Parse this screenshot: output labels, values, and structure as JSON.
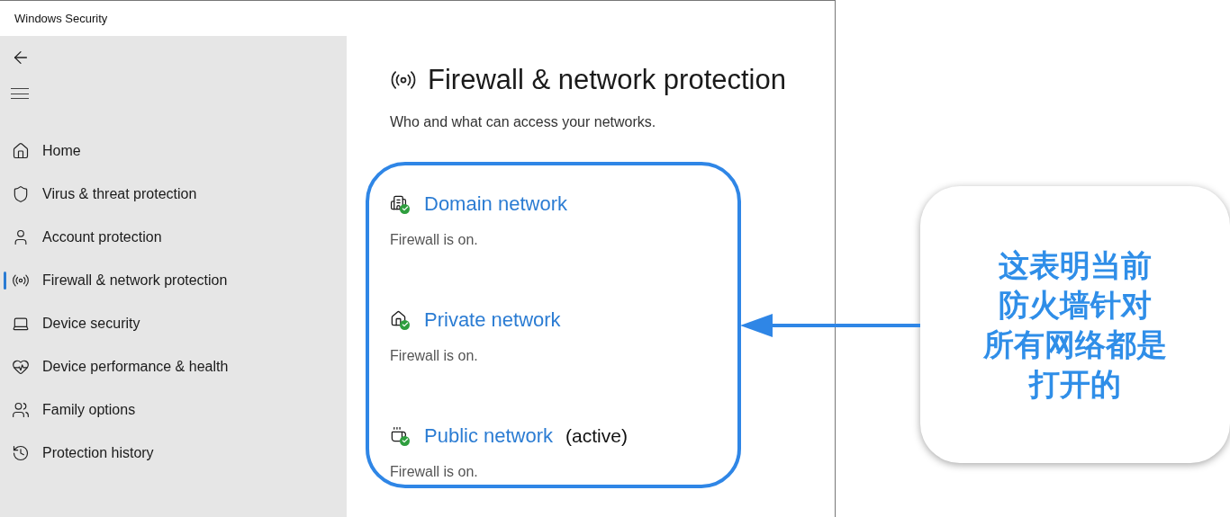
{
  "window": {
    "title": "Windows Security"
  },
  "sidebar": {
    "items": [
      {
        "label": "Home",
        "selected": false
      },
      {
        "label": "Virus & threat protection",
        "selected": false
      },
      {
        "label": "Account protection",
        "selected": false
      },
      {
        "label": "Firewall & network protection",
        "selected": true
      },
      {
        "label": "Device security",
        "selected": false
      },
      {
        "label": "Device performance & health",
        "selected": false
      },
      {
        "label": "Family options",
        "selected": false
      },
      {
        "label": "Protection history",
        "selected": false
      }
    ]
  },
  "page": {
    "title": "Firewall & network protection",
    "subtitle": "Who and what can access your networks."
  },
  "networks": [
    {
      "name": "Domain network",
      "status": "Firewall is on."
    },
    {
      "name": "Private network",
      "status": "Firewall is on."
    },
    {
      "name": "Public network",
      "suffix": "(active)",
      "status": "Firewall is on."
    }
  ],
  "callout": {
    "lines": [
      "这表明当前",
      "防火墙针对",
      "所有网络都是",
      "打开的"
    ]
  }
}
